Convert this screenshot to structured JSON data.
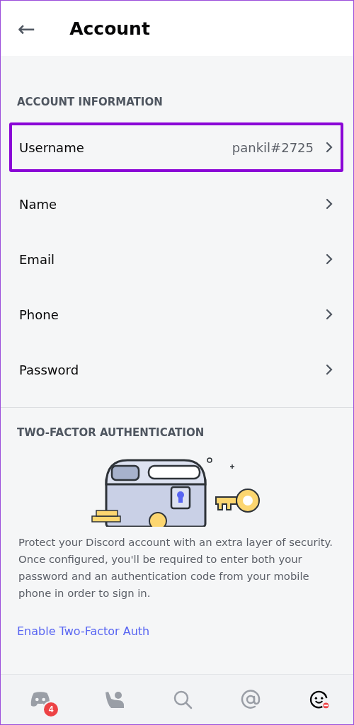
{
  "header": {
    "back": "←",
    "title": "Account"
  },
  "sections": [
    {
      "heading": "ACCOUNT INFORMATION",
      "rows": [
        {
          "label": "Username",
          "value": "pankil#2725",
          "selected": true
        },
        {
          "label": "Name",
          "selected": false
        },
        {
          "label": "Email",
          "selected": false
        },
        {
          "label": "Phone",
          "selected": false
        },
        {
          "label": "Password",
          "selected": false
        }
      ]
    },
    {
      "heading": "TWO-FACTOR AUTHENTICATION",
      "description": "Protect your Discord account with an extra layer of security. Once configured, you'll be required to enter both your password and an authentication code from your mobile phone in order to sign in.",
      "link": "Enable Two-Factor Auth"
    }
  ],
  "nav": [
    {
      "kind": "home",
      "badge": "4",
      "selected": false
    },
    {
      "kind": "friends",
      "selected": false
    },
    {
      "kind": "search",
      "selected": false
    },
    {
      "kind": "mentions",
      "selected": false
    },
    {
      "kind": "profile",
      "selected": true
    }
  ]
}
